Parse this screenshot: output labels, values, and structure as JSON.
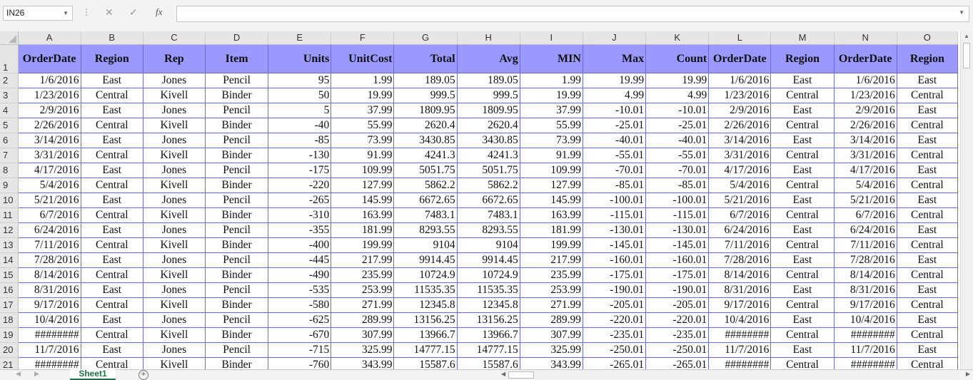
{
  "formula_bar": {
    "name_box": "IN26",
    "formula": "",
    "cancel_icon": "close-icon",
    "enter_icon": "check-icon",
    "fx_label": "fx"
  },
  "columns": [
    "A",
    "B",
    "C",
    "D",
    "E",
    "F",
    "G",
    "H",
    "I",
    "J",
    "K",
    "L",
    "M",
    "N",
    "O"
  ],
  "header_row": [
    "OrderDate",
    "Region",
    "Rep",
    "Item",
    "Units",
    "UnitCost",
    "Total",
    "Avg",
    "MIN",
    "Max",
    "Count",
    "OrderDate",
    "Region",
    "OrderDate",
    "Region"
  ],
  "rows": [
    [
      "1/6/2016",
      "East",
      "Jones",
      "Pencil",
      "95",
      "1.99",
      "189.05",
      "189.05",
      "1.99",
      "19.99",
      "19.99",
      "1/6/2016",
      "East",
      "1/6/2016",
      "East"
    ],
    [
      "1/23/2016",
      "Central",
      "Kivell",
      "Binder",
      "50",
      "19.99",
      "999.5",
      "999.5",
      "19.99",
      "4.99",
      "4.99",
      "1/23/2016",
      "Central",
      "1/23/2016",
      "Central"
    ],
    [
      "2/9/2016",
      "East",
      "Jones",
      "Pencil",
      "5",
      "37.99",
      "1809.95",
      "1809.95",
      "37.99",
      "-10.01",
      "-10.01",
      "2/9/2016",
      "East",
      "2/9/2016",
      "East"
    ],
    [
      "2/26/2016",
      "Central",
      "Kivell",
      "Binder",
      "-40",
      "55.99",
      "2620.4",
      "2620.4",
      "55.99",
      "-25.01",
      "-25.01",
      "2/26/2016",
      "Central",
      "2/26/2016",
      "Central"
    ],
    [
      "3/14/2016",
      "East",
      "Jones",
      "Pencil",
      "-85",
      "73.99",
      "3430.85",
      "3430.85",
      "73.99",
      "-40.01",
      "-40.01",
      "3/14/2016",
      "East",
      "3/14/2016",
      "East"
    ],
    [
      "3/31/2016",
      "Central",
      "Kivell",
      "Binder",
      "-130",
      "91.99",
      "4241.3",
      "4241.3",
      "91.99",
      "-55.01",
      "-55.01",
      "3/31/2016",
      "Central",
      "3/31/2016",
      "Central"
    ],
    [
      "4/17/2016",
      "East",
      "Jones",
      "Pencil",
      "-175",
      "109.99",
      "5051.75",
      "5051.75",
      "109.99",
      "-70.01",
      "-70.01",
      "4/17/2016",
      "East",
      "4/17/2016",
      "East"
    ],
    [
      "5/4/2016",
      "Central",
      "Kivell",
      "Binder",
      "-220",
      "127.99",
      "5862.2",
      "5862.2",
      "127.99",
      "-85.01",
      "-85.01",
      "5/4/2016",
      "Central",
      "5/4/2016",
      "Central"
    ],
    [
      "5/21/2016",
      "East",
      "Jones",
      "Pencil",
      "-265",
      "145.99",
      "6672.65",
      "6672.65",
      "145.99",
      "-100.01",
      "-100.01",
      "5/21/2016",
      "East",
      "5/21/2016",
      "East"
    ],
    [
      "6/7/2016",
      "Central",
      "Kivell",
      "Binder",
      "-310",
      "163.99",
      "7483.1",
      "7483.1",
      "163.99",
      "-115.01",
      "-115.01",
      "6/7/2016",
      "Central",
      "6/7/2016",
      "Central"
    ],
    [
      "6/24/2016",
      "East",
      "Jones",
      "Pencil",
      "-355",
      "181.99",
      "8293.55",
      "8293.55",
      "181.99",
      "-130.01",
      "-130.01",
      "6/24/2016",
      "East",
      "6/24/2016",
      "East"
    ],
    [
      "7/11/2016",
      "Central",
      "Kivell",
      "Binder",
      "-400",
      "199.99",
      "9104",
      "9104",
      "199.99",
      "-145.01",
      "-145.01",
      "7/11/2016",
      "Central",
      "7/11/2016",
      "Central"
    ],
    [
      "7/28/2016",
      "East",
      "Jones",
      "Pencil",
      "-445",
      "217.99",
      "9914.45",
      "9914.45",
      "217.99",
      "-160.01",
      "-160.01",
      "7/28/2016",
      "East",
      "7/28/2016",
      "East"
    ],
    [
      "8/14/2016",
      "Central",
      "Kivell",
      "Binder",
      "-490",
      "235.99",
      "10724.9",
      "10724.9",
      "235.99",
      "-175.01",
      "-175.01",
      "8/14/2016",
      "Central",
      "8/14/2016",
      "Central"
    ],
    [
      "8/31/2016",
      "East",
      "Jones",
      "Pencil",
      "-535",
      "253.99",
      "11535.35",
      "11535.35",
      "253.99",
      "-190.01",
      "-190.01",
      "8/31/2016",
      "East",
      "8/31/2016",
      "East"
    ],
    [
      "9/17/2016",
      "Central",
      "Kivell",
      "Binder",
      "-580",
      "271.99",
      "12345.8",
      "12345.8",
      "271.99",
      "-205.01",
      "-205.01",
      "9/17/2016",
      "Central",
      "9/17/2016",
      "Central"
    ],
    [
      "10/4/2016",
      "East",
      "Jones",
      "Pencil",
      "-625",
      "289.99",
      "13156.25",
      "13156.25",
      "289.99",
      "-220.01",
      "-220.01",
      "10/4/2016",
      "East",
      "10/4/2016",
      "East"
    ],
    [
      "########",
      "Central",
      "Kivell",
      "Binder",
      "-670",
      "307.99",
      "13966.7",
      "13966.7",
      "307.99",
      "-235.01",
      "-235.01",
      "########",
      "Central",
      "########",
      "Central"
    ],
    [
      "11/7/2016",
      "East",
      "Jones",
      "Pencil",
      "-715",
      "325.99",
      "14777.15",
      "14777.15",
      "325.99",
      "-250.01",
      "-250.01",
      "11/7/2016",
      "East",
      "11/7/2016",
      "East"
    ],
    [
      "########",
      "Central",
      "Kivell",
      "Binder",
      "-760",
      "343.99",
      "15587.6",
      "15587.6",
      "343.99",
      "-265.01",
      "-265.01",
      "########",
      "Central",
      "########",
      "Central"
    ]
  ],
  "sheet_tabs": [
    "Sheet1"
  ],
  "colors": {
    "header_fill": "#9999ff",
    "grid_border": "#6a6ae0",
    "active_tab": "#217346"
  }
}
